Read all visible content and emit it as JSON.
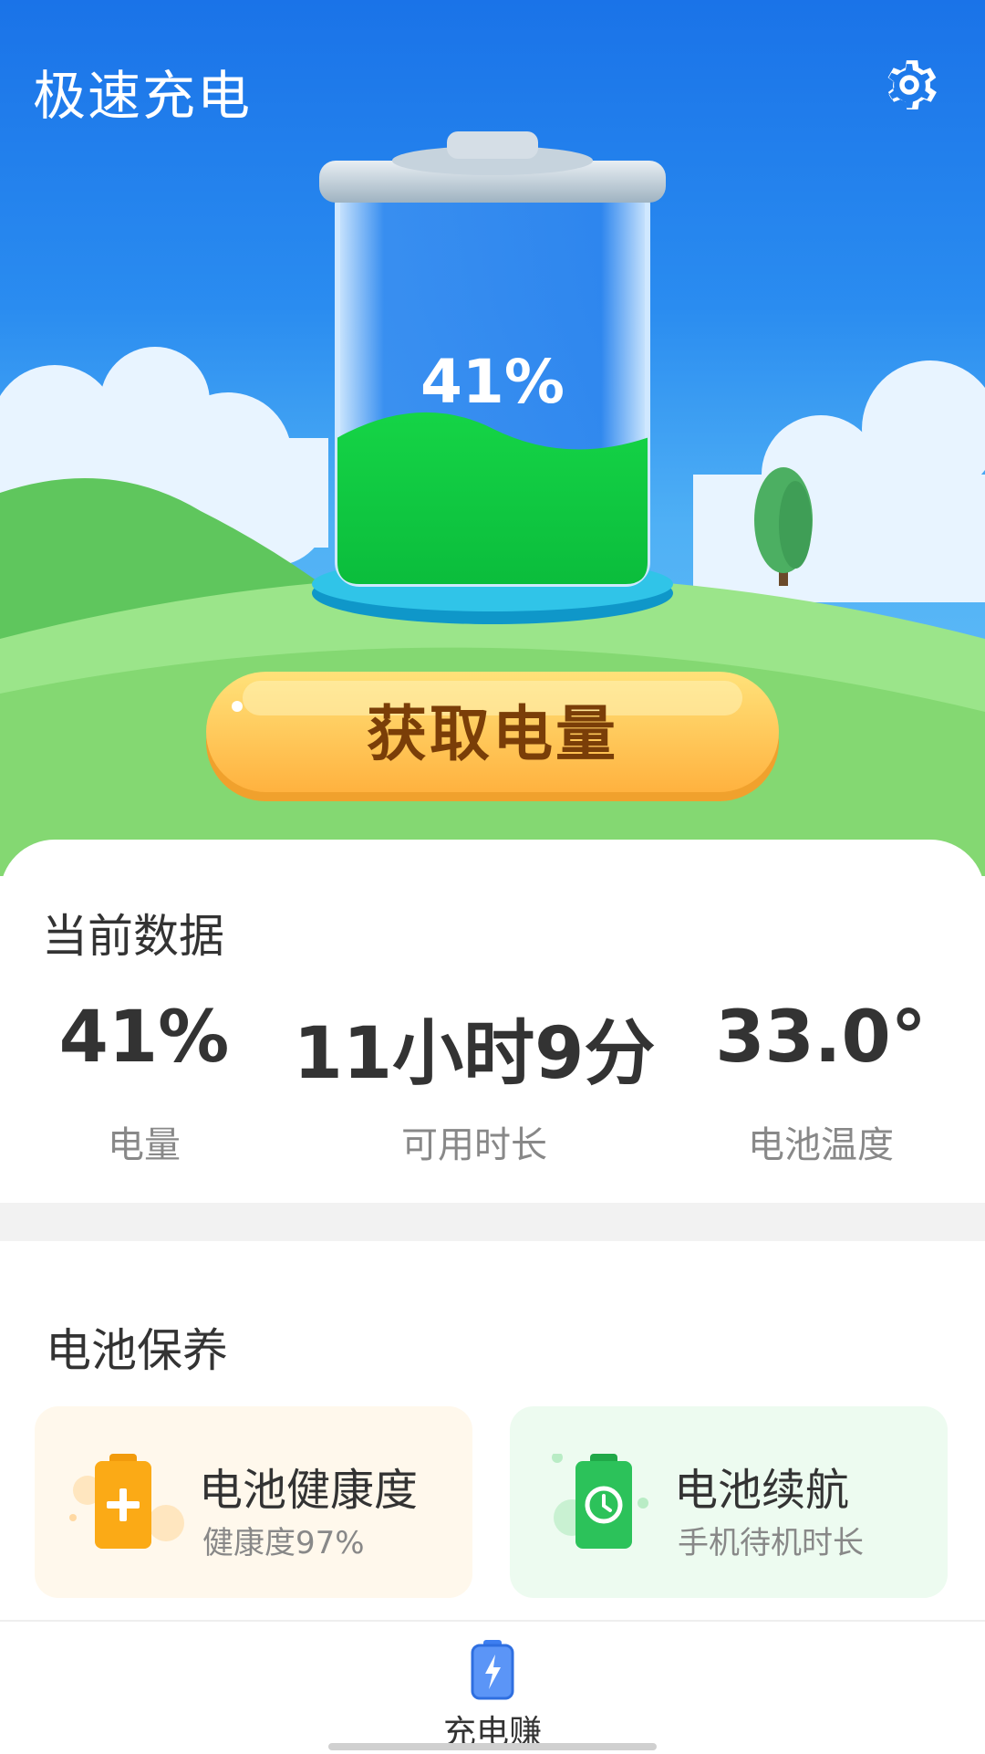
{
  "app": {
    "title": "极速充电",
    "icons": {
      "settings": "gear-icon"
    }
  },
  "battery": {
    "level": 0.41,
    "level_label": "41%"
  },
  "action": {
    "get_power_label": "获取电量"
  },
  "current_data": {
    "title": "当前数据",
    "stats": [
      {
        "value": "41%",
        "label": "电量"
      },
      {
        "value": "11小时9分",
        "label": "可用时长"
      },
      {
        "value": "33.0°",
        "label": "电池温度"
      }
    ]
  },
  "maintenance": {
    "title": "电池保养",
    "cards": [
      {
        "title": "电池健康度",
        "subtitle": "健康度97%",
        "icon": "battery-plus-icon",
        "bg": "#fff8ec"
      },
      {
        "title": "电池续航",
        "subtitle": "手机待机时长",
        "icon": "battery-timer-icon",
        "bg": "#edfbf0"
      }
    ]
  },
  "nav": {
    "tabs": [
      {
        "label": "充电赚",
        "icon": "battery-charge-icon"
      }
    ]
  }
}
